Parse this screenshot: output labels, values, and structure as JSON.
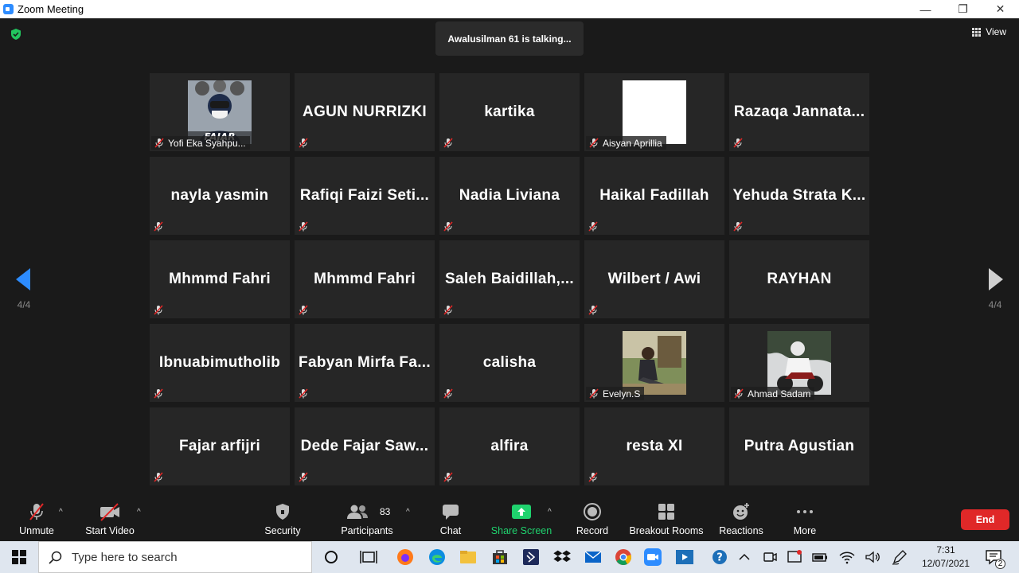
{
  "window": {
    "title": "Zoom Meeting",
    "minimize": "—",
    "restore": "❐",
    "close": "✕"
  },
  "meeting": {
    "talking_indicator": "Awalusilman 61 is talking...",
    "view_label": "View",
    "page_left": "4/4",
    "page_right": "4/4"
  },
  "participants": [
    {
      "name": "Yofi Eka Syahpu...",
      "type": "photo",
      "photo": "avatar-fajar"
    },
    {
      "name": "AGUN NURRIZKI",
      "type": "text"
    },
    {
      "name": "kartika",
      "type": "text"
    },
    {
      "name": "Aisyan Aprillia",
      "type": "photo",
      "photo": "blank"
    },
    {
      "name": "Razaqa  Jannata...",
      "type": "text"
    },
    {
      "name": "nayla yasmin",
      "type": "text"
    },
    {
      "name": "Rafiqi  Faizi  Seti...",
      "type": "text"
    },
    {
      "name": "Nadia Liviana",
      "type": "text"
    },
    {
      "name": "Haikal Fadillah",
      "type": "text"
    },
    {
      "name": "Yehuda  Strata  K...",
      "type": "text"
    },
    {
      "name": "Mhmmd Fahri",
      "type": "text"
    },
    {
      "name": "Mhmmd Fahri",
      "type": "text"
    },
    {
      "name": "Saleh  Baidillah,...",
      "type": "text"
    },
    {
      "name": "Wilbert / Awi",
      "type": "text"
    },
    {
      "name": "RAYHAN",
      "type": "text",
      "muted": false
    },
    {
      "name": "Ibnuabimutholib",
      "type": "text"
    },
    {
      "name": "Fabyan  Mirfa  Fa...",
      "type": "text"
    },
    {
      "name": "calisha",
      "type": "text"
    },
    {
      "name": "Evelyn.S",
      "type": "photo",
      "photo": "outdoor"
    },
    {
      "name": "Ahmad Sadam",
      "type": "photo",
      "photo": "motor"
    },
    {
      "name": "Fajar arfijri",
      "type": "text"
    },
    {
      "name": "Dede  Fajar  Saw...",
      "type": "text"
    },
    {
      "name": "alfira",
      "type": "text"
    },
    {
      "name": "resta XI",
      "type": "text"
    },
    {
      "name": "Putra Agustian",
      "type": "text",
      "muted": false
    }
  ],
  "avatar_text": "FAJAR",
  "toolbar": {
    "unmute": "Unmute",
    "start_video": "Start Video",
    "security": "Security",
    "participants": "Participants",
    "participants_count": "83",
    "chat": "Chat",
    "share_screen": "Share Screen",
    "record": "Record",
    "breakout_rooms": "Breakout Rooms",
    "reactions": "Reactions",
    "more": "More",
    "end": "End"
  },
  "taskbar": {
    "search_placeholder": "Type here to search",
    "time": "7:31",
    "date": "12/07/2021",
    "notifications": "2"
  },
  "colors": {
    "accent": "#2d8cff",
    "share_green": "#1fd26e",
    "end_red": "#e02828",
    "mute_red": "#e02828"
  }
}
